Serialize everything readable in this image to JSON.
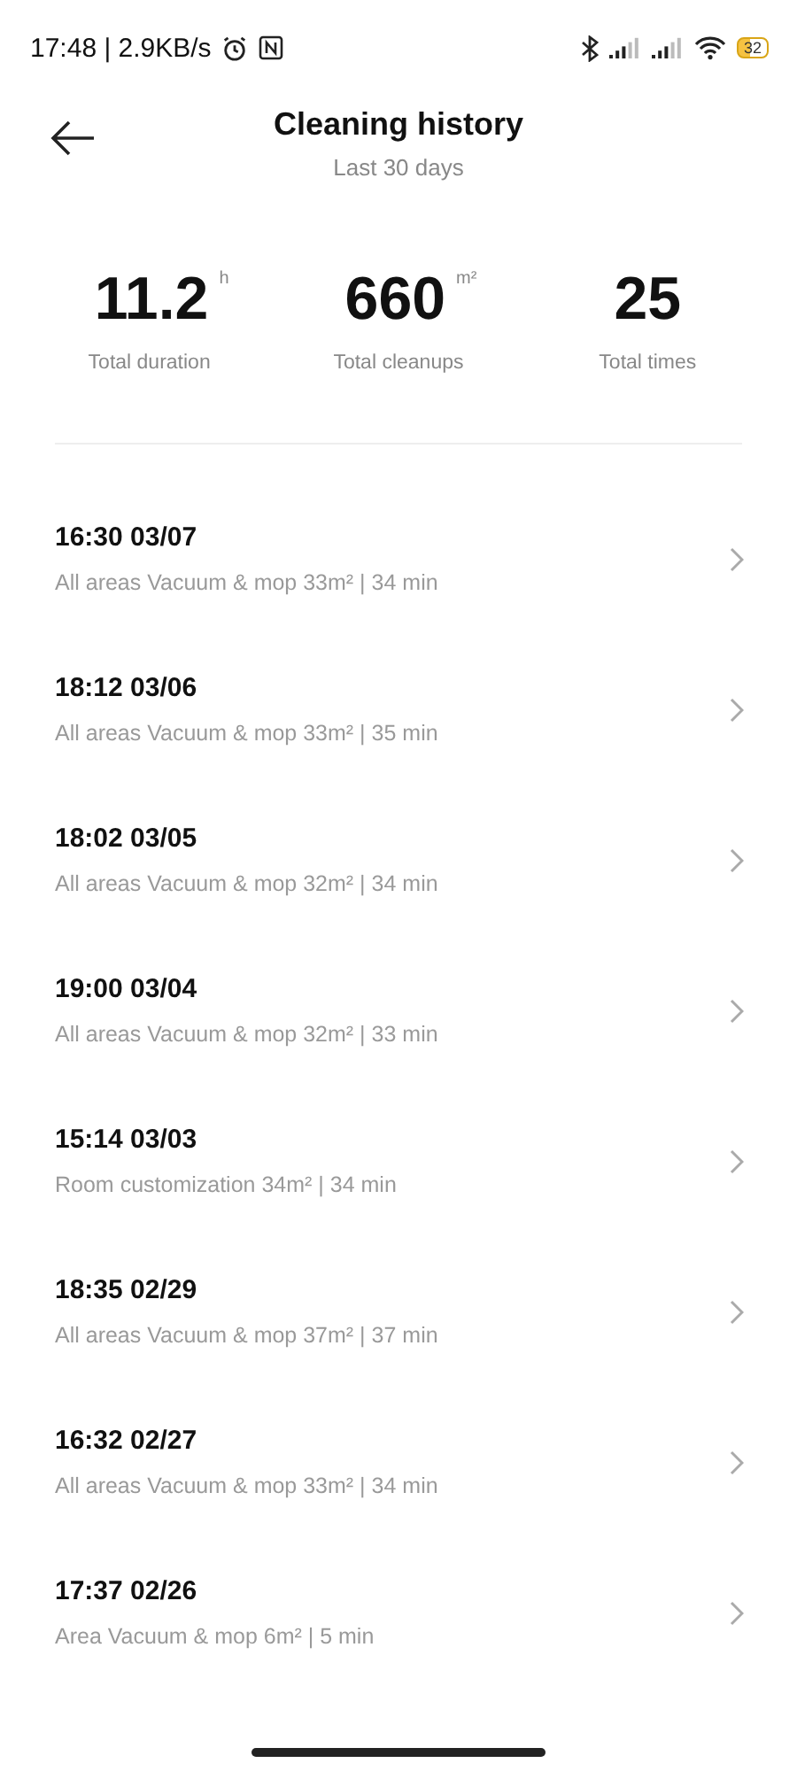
{
  "status_bar": {
    "time": "17:48 | 2.9KB/s",
    "battery": "32"
  },
  "header": {
    "title": "Cleaning history",
    "subtitle": "Last 30 days"
  },
  "stats": [
    {
      "value": "11.2",
      "unit": "h",
      "label": "Total duration"
    },
    {
      "value": "660",
      "unit": "m²",
      "label": "Total cleanups"
    },
    {
      "value": "25",
      "label": "Total times"
    }
  ],
  "records": [
    {
      "title": "16:30 03/07",
      "detail": "All areas Vacuum & mop 33m² | 34 min"
    },
    {
      "title": "18:12 03/06",
      "detail": "All areas Vacuum & mop 33m² | 35 min"
    },
    {
      "title": "18:02 03/05",
      "detail": "All areas Vacuum & mop 32m² | 34 min"
    },
    {
      "title": "19:00 03/04",
      "detail": "All areas Vacuum & mop 32m² | 33 min"
    },
    {
      "title": "15:14 03/03",
      "detail": "Room customization 34m² | 34 min"
    },
    {
      "title": "18:35 02/29",
      "detail": "All areas Vacuum & mop 37m² | 37 min"
    },
    {
      "title": "16:32 02/27",
      "detail": "All areas Vacuum & mop 33m² | 34 min"
    },
    {
      "title": "17:37 02/26",
      "detail": "Area Vacuum & mop 6m² | 5 min"
    }
  ]
}
